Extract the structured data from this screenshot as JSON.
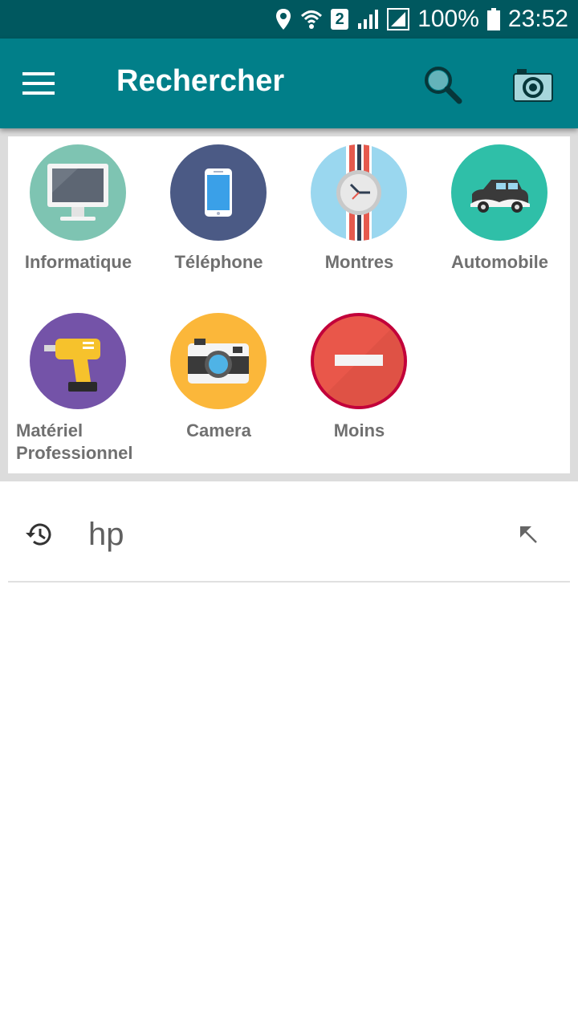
{
  "status_bar": {
    "battery": "100%",
    "time": "23:52",
    "sim_slot": "2",
    "icons": [
      "location-icon",
      "wifi-icon",
      "sim-2-icon",
      "signal-icon",
      "signal-icon",
      "battery-icon"
    ]
  },
  "app_bar": {
    "title": "Rechercher",
    "icons": [
      "menu-icon",
      "search-icon",
      "camera-icon"
    ],
    "background_color": "#017f89"
  },
  "categories": [
    {
      "label": "Informatique",
      "icon": "computer-icon",
      "color": "#7ec4b2"
    },
    {
      "label": "Téléphone",
      "icon": "phone-icon",
      "color": "#4b5a85"
    },
    {
      "label": "Montres",
      "icon": "watch-icon",
      "color": "#9ad7ef"
    },
    {
      "label": "Automobile",
      "icon": "car-icon",
      "color": "#2fbfa8"
    },
    {
      "label": "Matériel Professionnel",
      "icon": "drill-icon",
      "color": "#7453a8"
    },
    {
      "label": "Camera",
      "icon": "camera-icon",
      "color": "#fbb73a"
    },
    {
      "label": "Moins",
      "icon": "minus-icon",
      "color": "#e9574a"
    }
  ],
  "history": [
    {
      "query": "hp",
      "icon": "history-icon",
      "action_icon": "arrow-up-left-icon"
    }
  ]
}
